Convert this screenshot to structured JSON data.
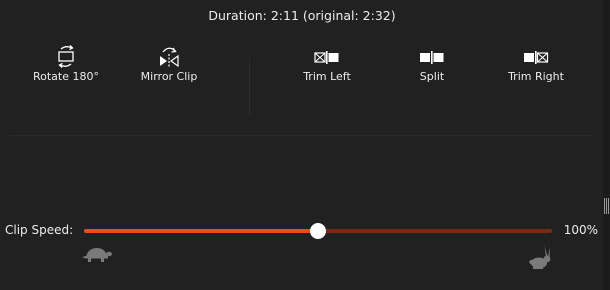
{
  "header": {
    "duration_text": "Duration: 2:11 (original: 2:32)"
  },
  "toolbar": {
    "rotate_label": "Rotate 180°",
    "mirror_label": "Mirror Clip",
    "trim_left_label": "Trim Left",
    "split_label": "Split",
    "trim_right_label": "Trim Right"
  },
  "speed": {
    "label": "Clip Speed:",
    "value_text": "100%",
    "slider_fraction": 0.5
  },
  "icons": {
    "rotate": "rotate-icon",
    "mirror": "mirror-icon",
    "trim_left": "trim-left-icon",
    "split": "split-icon",
    "trim_right": "trim-right-icon",
    "slow": "turtle-icon",
    "fast": "rabbit-icon"
  },
  "colors": {
    "background": "#212121",
    "accent": "#f04a19",
    "track": "#7a2a12",
    "text": "#ececec",
    "icon_muted": "#7a7a7a"
  }
}
